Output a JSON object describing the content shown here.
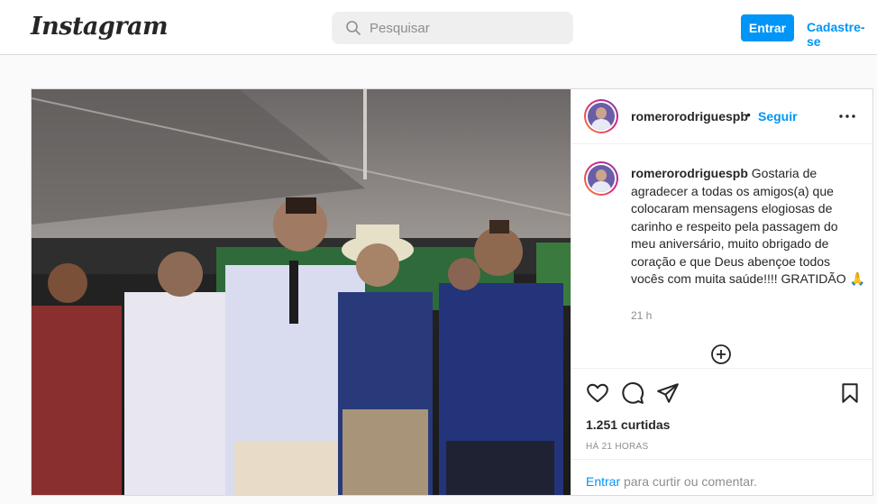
{
  "header": {
    "logo": "Instagram",
    "search_placeholder": "Pesquisar",
    "login_label": "Entrar",
    "signup_label": "Cadastre-se"
  },
  "post": {
    "username": "romerorodriguespb",
    "dot": "•",
    "follow_label": "Seguir",
    "caption_user": "romerorodriguespb",
    "caption_text": "Gostaria de agradecer a todas os amigos(a) que colocaram mensagens elogiosas de carinho e respeito pela passagem do meu aniversário, muito obrigado de coração e que Deus abençoe todos vocês com muita saúde!!!! GRATIDÃO 🙏",
    "caption_time": "21 h",
    "likes": "1.251 curtidas",
    "time_ago": "HÁ 21 HORAS",
    "footer_link": "Entrar",
    "footer_text": " para curtir ou comentar."
  },
  "icons": {
    "search": "search-icon",
    "more": "more-options-icon",
    "add": "add-circle-icon",
    "like": "heart-icon",
    "comment": "comment-icon",
    "share": "paper-plane-icon",
    "save": "bookmark-icon"
  },
  "colors": {
    "accent": "#0095f6",
    "text": "#262626",
    "muted": "#8e8e8e",
    "border": "#dbdbdb"
  }
}
